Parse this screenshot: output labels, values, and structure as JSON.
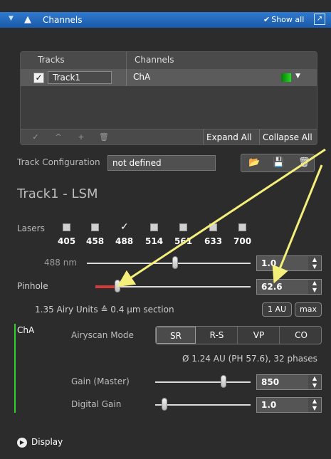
{
  "header": {
    "collapse_icon": "triangle-down",
    "warning_icon": "warning-triangle",
    "title": "Channels",
    "show_all": "Show all",
    "popout_icon": "popout"
  },
  "tracks_table": {
    "col_tracks": "Tracks",
    "col_channels": "Channels",
    "row": {
      "checked": "✓",
      "track": "Track1",
      "channel": "ChA",
      "channel_color": "#1fd01f"
    },
    "footer_icons": [
      "✓",
      "^",
      "+",
      "🗑"
    ],
    "expand_all": "Expand All",
    "collapse_all": "Collapse All"
  },
  "track_config": {
    "label": "Track Configuration",
    "value": "not defined",
    "buttons": [
      "📂",
      "💾",
      "🗑"
    ]
  },
  "track_title": "Track1 - LSM",
  "lasers": {
    "label": "Lasers",
    "wavelengths": [
      "405",
      "458",
      "488",
      "514",
      "561",
      "633",
      "700"
    ],
    "checked_index": 2,
    "check_glyph": "✓"
  },
  "laser_power": {
    "label": "488 nm",
    "value": "1.0",
    "level": 0.54
  },
  "pinhole": {
    "label": "Pinhole",
    "value": "62.6",
    "level": 0.14
  },
  "airy": {
    "text": "1.35 Airy Units  ≙  0.4 µm section",
    "btn_1au": "1 AU",
    "btn_max": "max"
  },
  "channel": {
    "name": "ChA",
    "airyscan_label": "Airyscan Mode",
    "modes": [
      "SR",
      "R-S",
      "VP",
      "CO"
    ],
    "active_mode": "SR",
    "diameter_text": "Ø 1.24 AU (PH 57.6), 32 phases",
    "gain_label": "Gain (Master)",
    "gain_value": "850",
    "gain_level": 0.72,
    "digital_label": "Digital Gain",
    "digital_value": "1.0",
    "digital_level": 0.1
  },
  "display": {
    "icon": "play-circle",
    "label": "Display"
  },
  "colors": {
    "header_blue": "#2a6fc4",
    "annotation_arrow": "#f4ef7a",
    "pinhole_fill": "#d43c3c"
  }
}
